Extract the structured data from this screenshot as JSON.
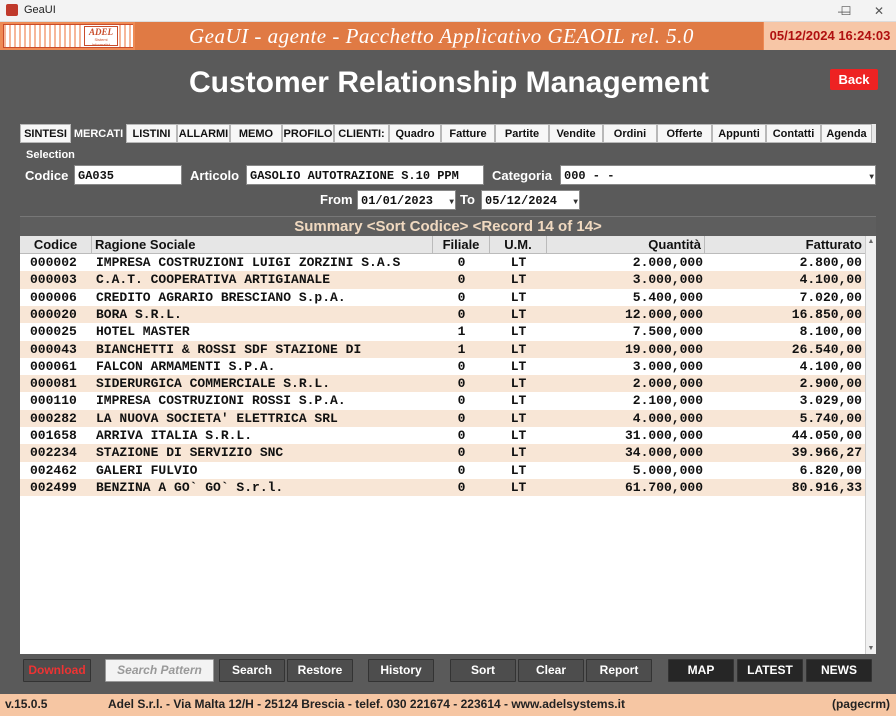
{
  "window": {
    "title": "GeaUI",
    "minimize": "—",
    "maximize": "☐",
    "close": "✕"
  },
  "header": {
    "logo_name": "ADEL",
    "logo_sub": "Sistemi Informativi",
    "app_title": "GeaUI - agente - Pacchetto Applicativo GEAOIL rel. 5.0",
    "datetime": "05/12/2024 16:24:03"
  },
  "page_title": "Customer Relationship Management",
  "back_label": "Back",
  "tabs": [
    "SINTESI",
    "MERCATI",
    "LISTINI",
    "ALLARMI",
    "MEMO",
    "PROFILO",
    "CLIENTI:",
    "Quadro",
    "Fatture",
    "Partite",
    "Vendite",
    "Ordini",
    "Offerte",
    "Appunti",
    "Contatti",
    "Agenda"
  ],
  "active_tab": "MERCATI",
  "selection": {
    "title": "Selection",
    "codice_label": "Codice",
    "codice_value": "GA035",
    "articolo_label": "Articolo",
    "articolo_value": "GASOLIO AUTOTRAZIONE S.10 PPM",
    "categoria_label": "Categoria",
    "categoria_value": "000 - -",
    "from_label": "From",
    "from_value": "01/01/2023",
    "to_label": "To",
    "to_value": "05/12/2024"
  },
  "summary": "Summary <Sort Codice> <Record 14 of 14>",
  "columns": [
    "Codice",
    "Ragione Sociale",
    "Filiale",
    "U.M.",
    "Quantità",
    "Fatturato"
  ],
  "rows": [
    [
      "000002",
      "IMPRESA COSTRUZIONI LUIGI ZORZINI S.A.S",
      "0",
      "LT",
      "2.000,000",
      "2.800,00"
    ],
    [
      "000003",
      "C.A.T. COOPERATIVA ARTIGIANALE",
      "0",
      "LT",
      "3.000,000",
      "4.100,00"
    ],
    [
      "000006",
      "CREDITO AGRARIO BRESCIANO S.p.A.",
      "0",
      "LT",
      "5.400,000",
      "7.020,00"
    ],
    [
      "000020",
      "BORA S.R.L.",
      "0",
      "LT",
      "12.000,000",
      "16.850,00"
    ],
    [
      "000025",
      "HOTEL MASTER",
      "1",
      "LT",
      "7.500,000",
      "8.100,00"
    ],
    [
      "000043",
      "BIANCHETTI & ROSSI SDF STAZIONE DI",
      "1",
      "LT",
      "19.000,000",
      "26.540,00"
    ],
    [
      "000061",
      "FALCON ARMAMENTI S.P.A.",
      "0",
      "LT",
      "3.000,000",
      "4.100,00"
    ],
    [
      "000081",
      "SIDERURGICA COMMERCIALE S.R.L.",
      "0",
      "LT",
      "2.000,000",
      "2.900,00"
    ],
    [
      "000110",
      "IMPRESA COSTRUZIONI ROSSI S.P.A.",
      "0",
      "LT",
      "2.100,000",
      "3.029,00"
    ],
    [
      "000282",
      "LA NUOVA SOCIETA' ELETTRICA SRL",
      "0",
      "LT",
      "4.000,000",
      "5.740,00"
    ],
    [
      "001658",
      "ARRIVA ITALIA S.R.L.",
      "0",
      "LT",
      "31.000,000",
      "44.050,00"
    ],
    [
      "002234",
      "STAZIONE DI SERVIZIO SNC",
      "0",
      "LT",
      "34.000,000",
      "39.966,27"
    ],
    [
      "002462",
      "GALERI FULVIO",
      "0",
      "LT",
      "5.000,000",
      "6.820,00"
    ],
    [
      "002499",
      "BENZINA A GO` GO` S.r.l.",
      "0",
      "LT",
      "61.700,000",
      "80.916,33"
    ]
  ],
  "buttons": {
    "download": "Download",
    "search_pattern": "Search Pattern",
    "search": "Search",
    "restore": "Restore",
    "history": "History",
    "sort": "Sort",
    "clear": "Clear",
    "report": "Report",
    "map": "MAP",
    "latest": "LATEST",
    "news": "NEWS"
  },
  "footer": {
    "version": "v.15.0.5",
    "address": "Adel S.r.l. - Via Malta 12/H - 25124 Brescia - telef. 030 221674 - 223614 - www.adelsystems.it",
    "page": "(pagecrm)"
  }
}
